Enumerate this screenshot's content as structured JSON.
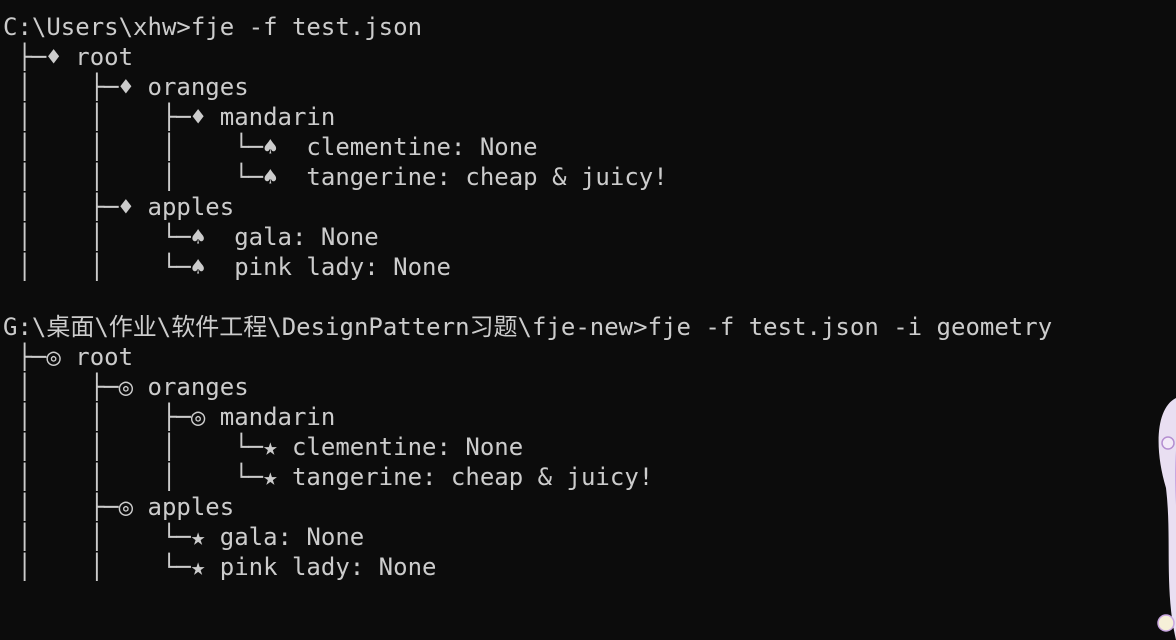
{
  "terminal": {
    "session1": {
      "prompt": "C:\\Users\\xhw>fje -f test.json",
      "lines": [
        " ├─♦ root",
        " │    ├─♦ oranges",
        " │    │    ├─♦ mandarin",
        " │    │    │    └─♠  clementine: None",
        " │    │    │    └─♠  tangerine: cheap & juicy!",
        " │    ├─♦ apples",
        " │    │    └─♠  gala: None",
        " │    │    └─♠  pink lady: None"
      ]
    },
    "session2": {
      "prompt": "G:\\桌面\\作业\\软件工程\\DesignPattern习题\\fje-new>fje -f test.json -i geometry",
      "lines": [
        " ├─◎ root",
        " │    ├─◎ oranges",
        " │    │    ├─◎ mandarin",
        " │    │    │    └─★ clementine: None",
        " │    │    │    └─★ tangerine: cheap & juicy!",
        " │    ├─◎ apples",
        " │    │    └─★ gala: None",
        " │    │    └─★ pink lady: None"
      ]
    }
  },
  "colors": {
    "background": "#0c0c0c",
    "text": "#cccccc",
    "mascot_hair": "#e9dff2",
    "mascot_accent": "#c9a6e0"
  },
  "icons": {
    "container_style1": "diamond-icon",
    "leaf_style1": "spade-icon",
    "container_style2": "bullseye-icon",
    "leaf_style2": "star-icon"
  }
}
